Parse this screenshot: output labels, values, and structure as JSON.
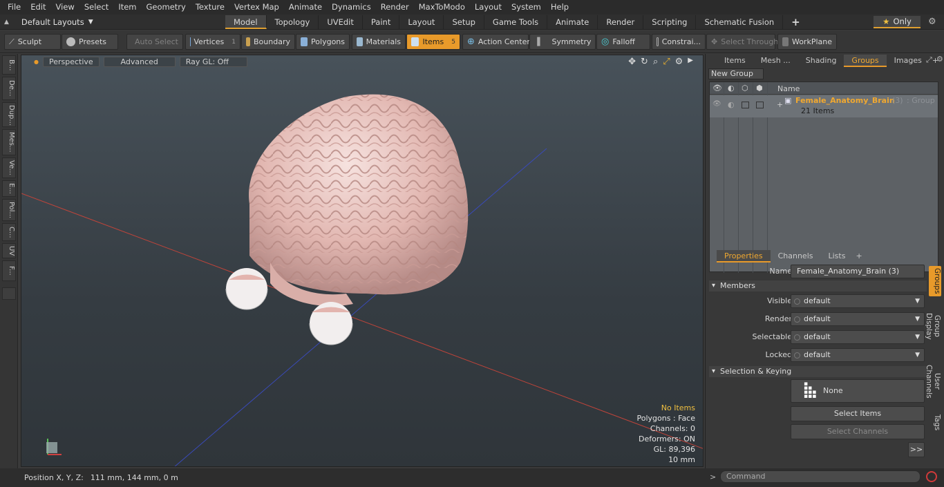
{
  "menu": [
    "File",
    "Edit",
    "View",
    "Select",
    "Item",
    "Geometry",
    "Texture",
    "Vertex Map",
    "Animate",
    "Dynamics",
    "Render",
    "MaxToModo",
    "Layout",
    "System",
    "Help"
  ],
  "layout": {
    "selector": "Default Layouts",
    "tabs": [
      {
        "label": "Model",
        "active": true
      },
      {
        "label": "Topology"
      },
      {
        "label": "UVEdit"
      },
      {
        "label": "Paint"
      },
      {
        "label": "Layout"
      },
      {
        "label": "Setup"
      },
      {
        "label": "Game Tools"
      },
      {
        "label": "Animate"
      },
      {
        "label": "Render"
      },
      {
        "label": "Scripting"
      },
      {
        "label": "Schematic Fusion"
      }
    ],
    "add": "+",
    "only_label": "Only"
  },
  "toolbar": {
    "sculpt": "Sculpt",
    "presets": "Presets",
    "auto_select": "Auto Select",
    "vertices": "Vertices",
    "vertices_count": "1",
    "boundary": "Boundary",
    "polygons": "Polygons",
    "materials": "Materials",
    "items": "Items",
    "items_count": "5",
    "action_center": "Action Center",
    "symmetry": "Symmetry",
    "falloff": "Falloff",
    "constraints": "Constrai...",
    "select_through": "Select Through",
    "workplane": "WorkPlane"
  },
  "left_tabs": [
    "B...",
    "De...",
    "Dup...",
    "Mes...",
    "Ve...",
    "E...",
    "Pol...",
    "C...",
    "UV",
    "F..."
  ],
  "viewport": {
    "perspective": "Perspective",
    "advanced": "Advanced",
    "raygl": "Ray GL: Off",
    "info": {
      "items": "No Items",
      "polygons": "Polygons : Face",
      "channels": "Channels: 0",
      "deformers": "Deformers: ON",
      "gl": "GL: 89,396",
      "scale": "10 mm"
    }
  },
  "status": {
    "label": "Position X, Y, Z:",
    "value": "111 mm, 144 mm, 0 m"
  },
  "right_panel": {
    "top_tabs": [
      {
        "label": "Items"
      },
      {
        "label": "Mesh ..."
      },
      {
        "label": "Shading"
      },
      {
        "label": "Groups",
        "active": true
      },
      {
        "label": "Images"
      }
    ],
    "new_group": "New Group",
    "column_name": "Name",
    "group": {
      "name": "Female_Anatomy_Brain",
      "count": "(3)",
      "type": ": Group",
      "items": "21 Items"
    },
    "bottom_tabs": [
      {
        "label": "Properties",
        "active": true
      },
      {
        "label": "Channels"
      },
      {
        "label": "Lists"
      }
    ],
    "properties": {
      "name_label": "Name",
      "name_value": "Female_Anatomy_Brain (3)",
      "members": "Members",
      "visible_label": "Visible",
      "visible_value": "default",
      "render_label": "Render",
      "render_value": "default",
      "selectable_label": "Selectable",
      "selectable_value": "default",
      "locked_label": "Locked",
      "locked_value": "default",
      "sel_keying": "Selection & Keying",
      "none": "None",
      "select_items": "Select Items",
      "select_channels": "Select Channels",
      "more": ">>"
    },
    "side_tabs": [
      {
        "label": "Groups",
        "active": true
      },
      {
        "label": "Group Display"
      },
      {
        "label": "User Channels"
      },
      {
        "label": "Tags"
      }
    ],
    "command_placeholder": "Command"
  },
  "colors": {
    "accent": "#e89a2a",
    "group_name": "#f0a830"
  }
}
